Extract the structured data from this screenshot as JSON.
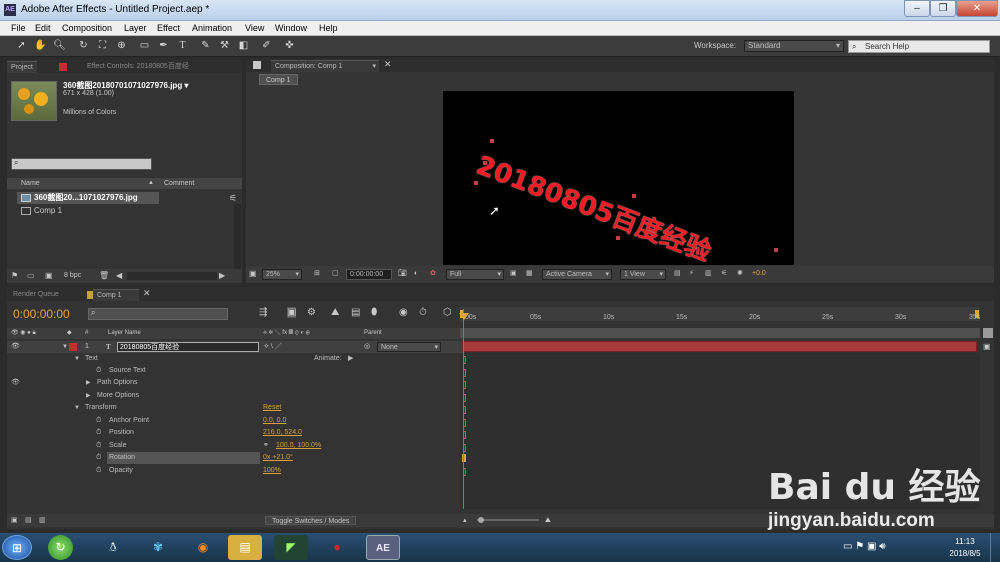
{
  "window": {
    "title": "Adobe After Effects - Untitled Project.aep *",
    "logo": "AE"
  },
  "menu": [
    "File",
    "Edit",
    "Composition",
    "Layer",
    "Effect",
    "Animation",
    "View",
    "Window",
    "Help"
  ],
  "toolbar": {
    "workspace_label": "Workspace:",
    "workspace_value": "Standard",
    "search_placeholder": "Search Help"
  },
  "project": {
    "tab_project": "Project",
    "tab_effects": "Effect Controls: 20180805百度经",
    "item_name": "360截图20180701071027976.jpg ▾",
    "item_dims": "671 x 428 (1.00)",
    "item_colors": "Millions of Colors",
    "col_name": "Name",
    "col_comment": "Comment",
    "rows": [
      "360截图20...1071027976.jpg",
      "Comp 1"
    ],
    "bpc": "8 bpc"
  },
  "composition": {
    "tab_label": "Composition: Comp 1",
    "subtab": "Comp 1",
    "text_layer": "20180805百度经验",
    "zoom": "25%",
    "timecode": "0:00:00:00",
    "resolution": "Full",
    "camera": "Active Camera",
    "view": "1 View",
    "exposure": "+0.0"
  },
  "timeline": {
    "tab_render": "Render Queue",
    "tab_comp": "Comp 1",
    "current_time": "0:00:00:00",
    "col_layer_name": "Layer Name",
    "col_parent": "Parent",
    "layer_index": "1",
    "layer_name": "20180805百度经验",
    "parent_value": "None",
    "animate_label": "Animate:",
    "props": [
      {
        "label": "Text",
        "indent": 0,
        "value": ""
      },
      {
        "label": "Source Text",
        "indent": 2,
        "value": ""
      },
      {
        "label": "Path Options",
        "indent": 1,
        "value": ""
      },
      {
        "label": "More Options",
        "indent": 1,
        "value": ""
      },
      {
        "label": "Transform",
        "indent": 0,
        "value": "Reset"
      },
      {
        "label": "Anchor Point",
        "indent": 2,
        "value": "0.0, 0.0"
      },
      {
        "label": "Position",
        "indent": 2,
        "value": "216.0, 524.0"
      },
      {
        "label": "Scale",
        "indent": 2,
        "value": "100.0, 100.0%"
      },
      {
        "label": "Rotation",
        "indent": 2,
        "value": "0x +21.0°"
      },
      {
        "label": "Opacity",
        "indent": 2,
        "value": "100%"
      }
    ],
    "ruler_labels": [
      "00s",
      "05s",
      "10s",
      "15s",
      "20s",
      "25s",
      "30s",
      "35s"
    ],
    "toggle_label": "Toggle Switches / Modes"
  },
  "watermark": {
    "brand": "Bai du 经验",
    "url": "jingyan.baidu.com"
  },
  "taskbar": {
    "time": "11:13",
    "date": "2018/8/5",
    "ae_label": "AE"
  }
}
